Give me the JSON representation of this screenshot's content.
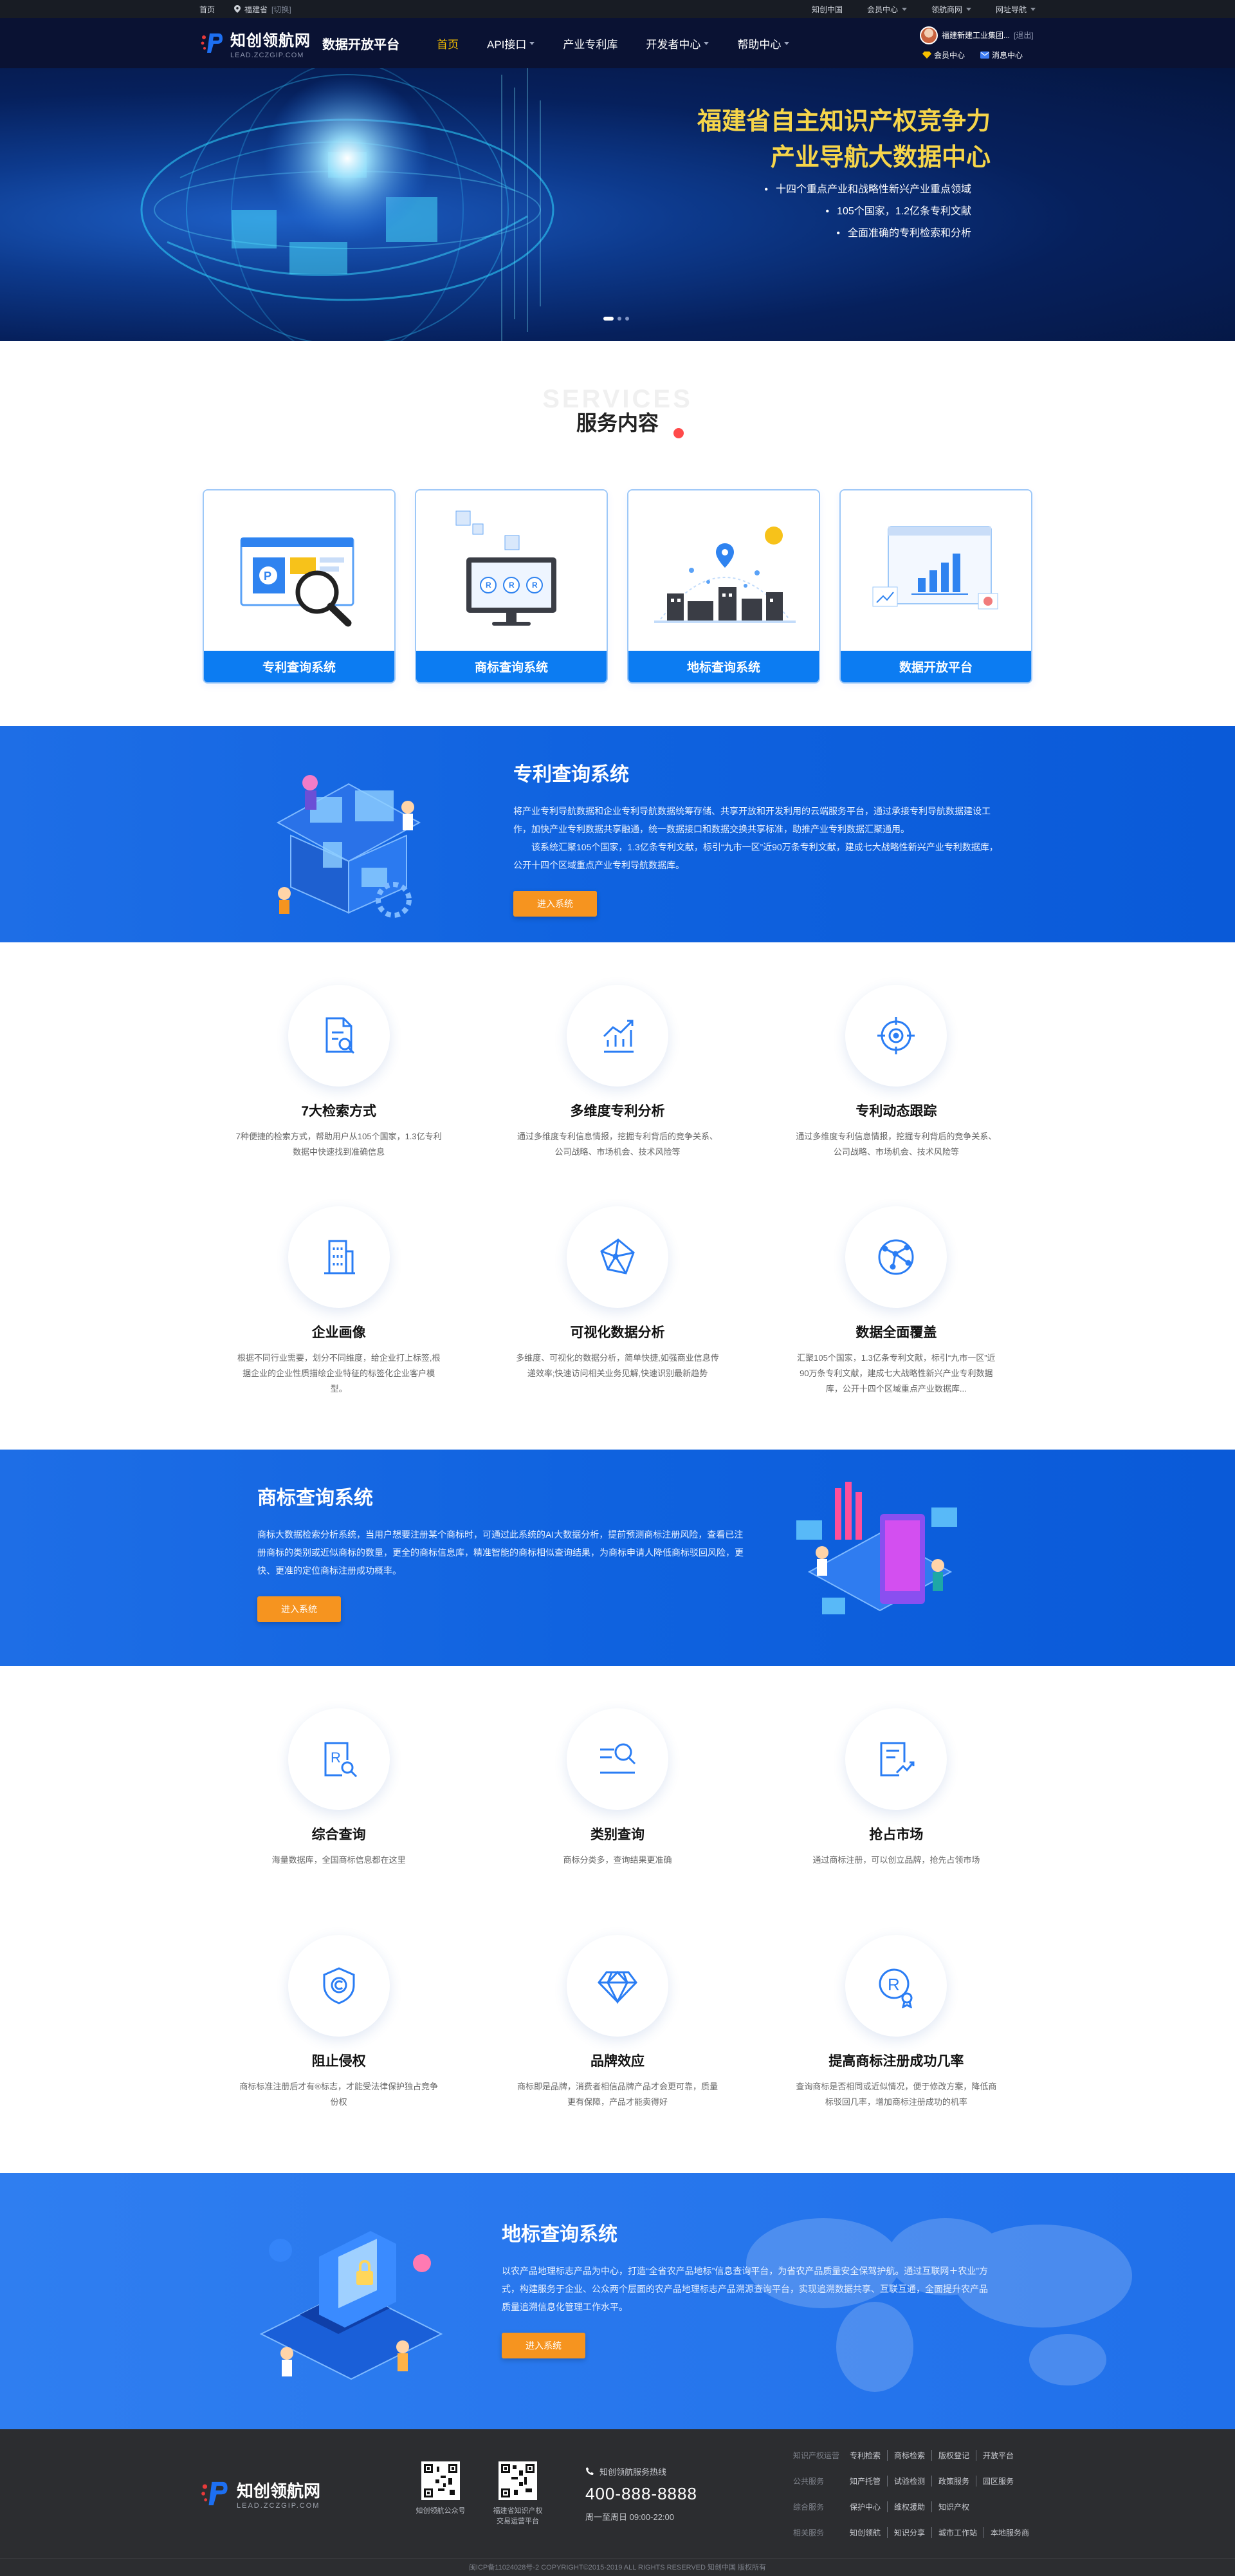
{
  "topbar": {
    "home": "首页",
    "location": "福建省",
    "location_switch": "[切换]",
    "links": [
      "知创中国",
      "会员中心",
      "领航商网",
      "网址导航"
    ]
  },
  "header": {
    "logo_cn": "知创领航网",
    "logo_en": "LEAD.ZCZGIP.COM",
    "platform": "数据开放平台",
    "nav": [
      "首页",
      "API接口",
      "产业专利库",
      "开发者中心",
      "帮助中心"
    ],
    "user_name": "福建新建工业集团...",
    "user_exit": "[退出]",
    "user_links": [
      "会员中心",
      "消息中心"
    ]
  },
  "banner": {
    "title_line1": "福建省自主知识产权竞争力",
    "title_line2": "产业导航大数据中心",
    "bullets": [
      "十四个重点产业和战略性新兴产业重点领域",
      "105个国家，1.2亿条专利文献",
      "全面准确的专利检索和分析"
    ]
  },
  "services": {
    "title_en": "SERVICES",
    "title": "服务内容",
    "cards": [
      "专利查询系统",
      "商标查询系统",
      "地标查询系统",
      "数据开放平台"
    ]
  },
  "patent": {
    "title": "专利查询系统",
    "desc1": "将产业专利导航数据和企业专利导航数据统筹存储、共享开放和开发利用的云端服务平台，通过承接专利导航数据建设工作，加快产业专利数据共享融通，统一数据接口和数据交换共享标准，助推产业专利数据汇聚通用。",
    "desc2": "该系统汇聚105个国家，1.3亿条专利文献，标引“九市一区”近90万条专利文献，建成七大战略性新兴产业专利数据库，公开十四个区域重点产业专利导航数据库。",
    "button": "进入系统",
    "features": [
      {
        "title": "7大检索方式",
        "desc": "7种便捷的检索方式，帮助用户从105个国家，1.3亿专利数据中快速找到准确信息"
      },
      {
        "title": "多维度专利分析",
        "desc": "通过多维度专利信息情报，挖掘专利背后的竞争关系、公司战略、市场机会、技术风险等"
      },
      {
        "title": "专利动态跟踪",
        "desc": "通过多维度专利信息情报，挖掘专利背后的竞争关系、公司战略、市场机会、技术风险等"
      },
      {
        "title": "企业画像",
        "desc": "根据不同行业需要，划分不同维度，给企业打上标签,根据企业的企业性质描绘企业特征的标签化企业客户模型。"
      },
      {
        "title": "可视化数据分析",
        "desc": "多维度、可视化的数据分析，简单快捷,如强商业信息传递效率;快速访问相关业务见解,快速识别最新趋势"
      },
      {
        "title": "数据全面覆盖",
        "desc": "汇聚105个国家，1.3亿条专利文献，标引“九市一区”近90万条专利文献，建成七大战略性新兴产业专利数据库，公开十四个区域重点产业数据库..."
      }
    ]
  },
  "trademark": {
    "title": "商标查询系统",
    "desc": "商标大数据检索分析系统，当用户想要注册某个商标时，可通过此系统的AI大数据分析，提前预测商标注册风险，查看已注册商标的类别或近似商标的数量，更全的商标信息库，精准智能的商标相似查询结果，为商标申请人降低商标驳回风险，更快、更准的定位商标注册成功概率。",
    "button": "进入系统",
    "features": [
      {
        "title": "综合查询",
        "desc": "海量数据库，全国商标信息都在这里"
      },
      {
        "title": "类别查询",
        "desc": "商标分类多，查询结果更准确"
      },
      {
        "title": "抢占市场",
        "desc": "通过商标注册，可以创立品牌，抢先占领市场"
      },
      {
        "title": "阻止侵权",
        "desc": "商标标准注册后才有®标志，才能受法律保护独占竞争份权"
      },
      {
        "title": "品牌效应",
        "desc": "商标即是品牌，消费者相信品牌产品才会更可靠，质量更有保障，产品才能卖得好"
      },
      {
        "title": "提高商标注册成功几率",
        "desc": "查询商标是否相同或近似情况，便于修改方案，降低商标驳回几率，增加商标注册成功的机率"
      }
    ]
  },
  "landmark": {
    "title": "地标查询系统",
    "desc": "以农产品地理标志产品为中心，打造“全省农产品地标”信息查询平台，为省农产品质量安全保驾护航。通过互联网＋农业”方式，构建服务于企业、公众两个层面的农产品地理标志产品溯源查询平台，实现追溯数据共享、互联互通，全面提升农产品质量追溯信息化管理工作水平。",
    "button": "进入系统"
  },
  "footer": {
    "logo_cn": "知创领航网",
    "logo_en": "LEAD.ZCZGIP.COM",
    "qr1": "知创领航公众号",
    "qr2": "福建省知识产权\n交易运营平台",
    "hotline_label": "知创领航服务热线",
    "hotline": "400-888-8888",
    "hours": "周一至周日 09:00-22:00",
    "link_rows": [
      {
        "cat": "知识产权运营",
        "items": [
          "专利检索",
          "商标检索",
          "版权登记",
          "开放平台"
        ]
      },
      {
        "cat": "公共服务",
        "items": [
          "知产托管",
          "试验检测",
          "政策服务",
          "园区服务"
        ]
      },
      {
        "cat": "综合服务",
        "items": [
          "保护中心",
          "维权援助",
          "知识产权"
        ]
      },
      {
        "cat": "相关服务",
        "items": [
          "知创领航",
          "知识分享",
          "城市工作站",
          "本地服务商"
        ]
      }
    ],
    "copyright": "闽ICP备11024028号-2 COPYRIGHT©2015-2019 ALL RIGHTS RESERVED 知创中国 版权所有"
  },
  "colors": {
    "primary": "#0c7cf2",
    "nav_active": "#f7c000",
    "button": "#f6941f",
    "footer": "#2c2d30"
  }
}
